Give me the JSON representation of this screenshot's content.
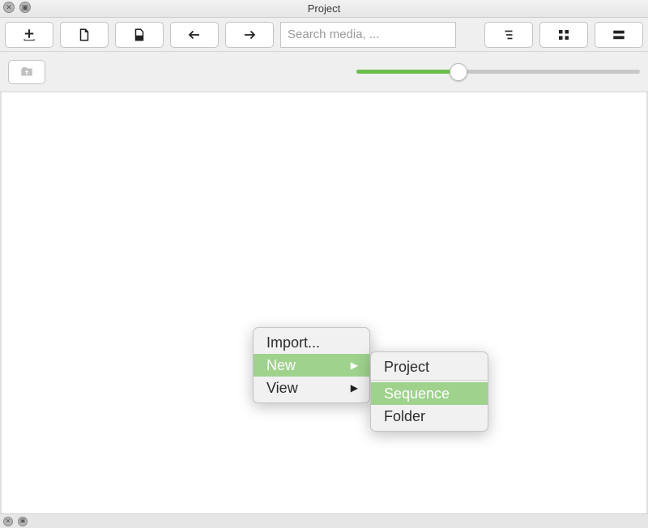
{
  "window": {
    "title": "Project"
  },
  "toolbar": {
    "search_placeholder": "Search media, ..."
  },
  "context_menu": {
    "items": [
      {
        "label": "Import...",
        "has_submenu": false,
        "highlighted": false
      },
      {
        "label": "New",
        "has_submenu": true,
        "highlighted": true
      },
      {
        "label": "View",
        "has_submenu": true,
        "highlighted": false
      }
    ]
  },
  "submenu_new": {
    "items": [
      {
        "label": "Project",
        "highlighted": false
      },
      {
        "label": "Sequence",
        "highlighted": true
      },
      {
        "label": "Folder",
        "highlighted": false
      }
    ]
  },
  "icons": {
    "add": "add-icon",
    "new_file": "new-file-icon",
    "open_file": "open-file-icon",
    "undo": "undo-icon",
    "redo": "redo-icon",
    "list_view": "list-view-icon",
    "grid_view": "grid-view-icon",
    "tile_view": "tile-view-icon",
    "path_up": "folder-up-icon",
    "close": "close-icon",
    "minimize": "minimize-icon"
  },
  "colors": {
    "accent": "#6cbf4b",
    "highlight": "#9fd28d"
  },
  "slider": {
    "percent": 36
  }
}
